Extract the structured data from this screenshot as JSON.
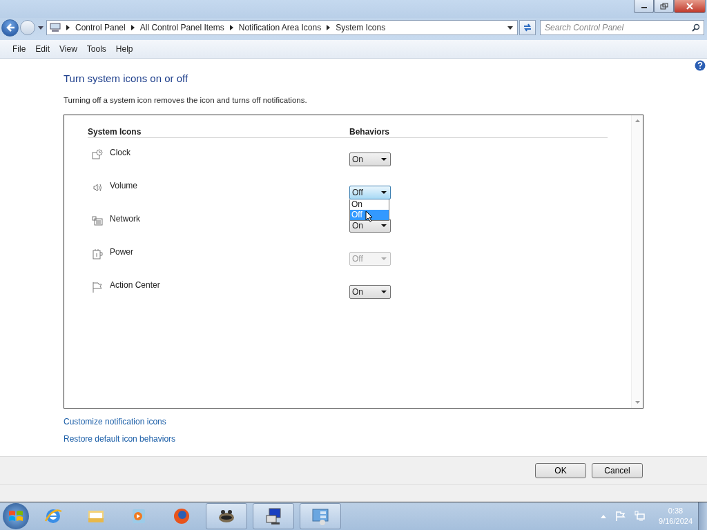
{
  "address_bar": {
    "breadcrumbs": [
      "Control Panel",
      "All Control Panel Items",
      "Notification Area Icons",
      "System Icons"
    ],
    "search": {
      "placeholder": "Search Control Panel"
    }
  },
  "menu": [
    "File",
    "Edit",
    "View",
    "Tools",
    "Help"
  ],
  "heading": "Turn system icons on or off",
  "description": "Turning off a system icon removes the icon and turns off notifications.",
  "table": {
    "columns": [
      "System Icons",
      "Behaviors"
    ],
    "rows": [
      {
        "name": "Clock",
        "kind": "clock",
        "value": "On",
        "disabled": false,
        "open": false
      },
      {
        "name": "Volume",
        "kind": "volume",
        "value": "Off",
        "disabled": false,
        "open": true
      },
      {
        "name": "Network",
        "kind": "network",
        "value": "On",
        "disabled": false,
        "open": false
      },
      {
        "name": "Power",
        "kind": "power",
        "value": "Off",
        "disabled": true,
        "open": false
      },
      {
        "name": "Action Center",
        "kind": "flag",
        "value": "On",
        "disabled": false,
        "open": false
      }
    ],
    "dropdown_options": [
      {
        "label": "On",
        "selected": false
      },
      {
        "label": "Off",
        "selected": true
      }
    ]
  },
  "links": [
    "Customize notification icons",
    "Restore default icon behaviors"
  ],
  "buttons": [
    "OK",
    "Cancel"
  ],
  "taskbar": {
    "apps": [
      {
        "kind": "browser",
        "running": false
      },
      {
        "kind": "folder",
        "running": false
      },
      {
        "kind": "media",
        "running": false
      },
      {
        "kind": "globe",
        "running": false
      },
      {
        "kind": "raccoon",
        "running": true
      },
      {
        "kind": "installer",
        "running": true
      },
      {
        "kind": "panel",
        "running": true
      }
    ],
    "time": "0:38",
    "date": "9/16/2024"
  }
}
